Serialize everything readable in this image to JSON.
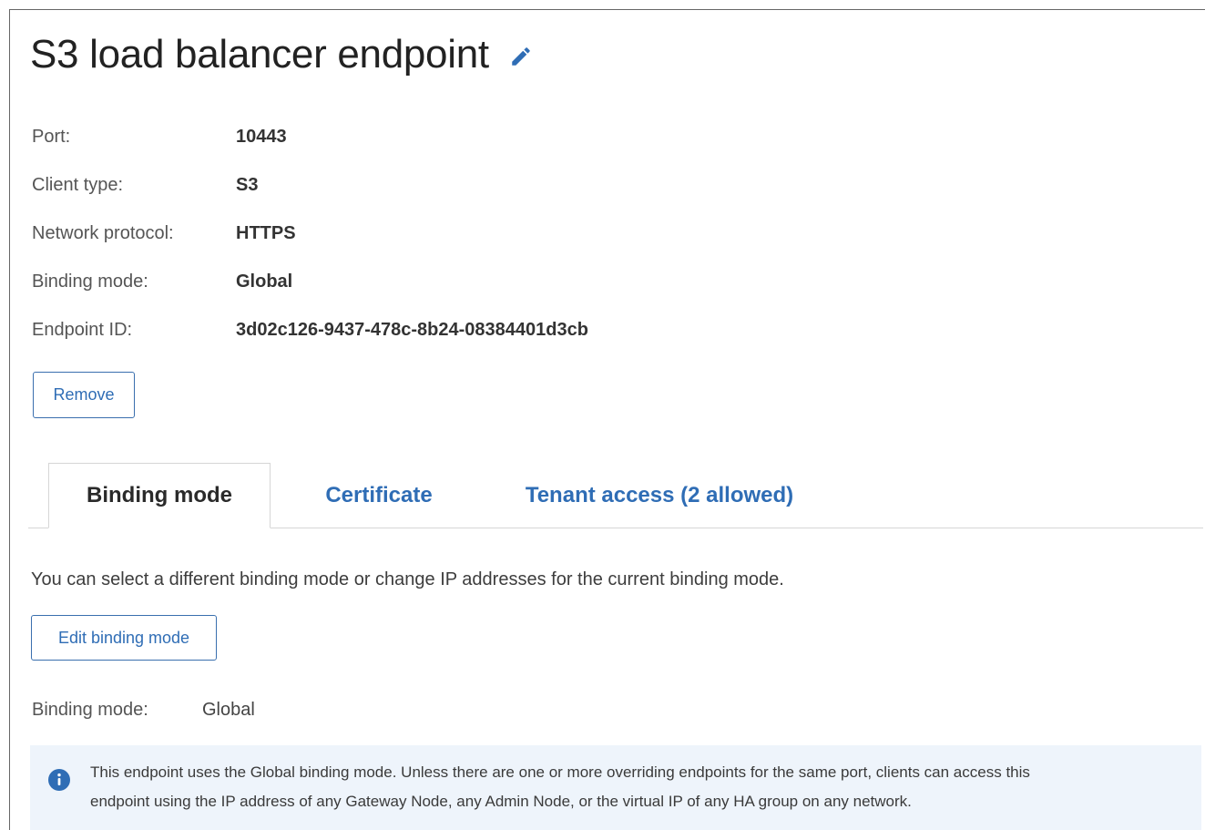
{
  "header": {
    "title": "S3 load balancer endpoint",
    "edit_icon": "pencil-icon",
    "accent_color": "#2f6db5"
  },
  "properties": [
    {
      "label": "Port:",
      "value": "10443"
    },
    {
      "label": "Client type:",
      "value": "S3"
    },
    {
      "label": "Network protocol:",
      "value": "HTTPS"
    },
    {
      "label": "Binding mode:",
      "value": "Global"
    },
    {
      "label": "Endpoint ID:",
      "value": "3d02c126-9437-478c-8b24-08384401d3cb"
    }
  ],
  "actions": {
    "remove_label": "Remove"
  },
  "tabs": [
    {
      "label": "Binding mode",
      "active": true
    },
    {
      "label": "Certificate",
      "active": false
    },
    {
      "label": "Tenant access (2 allowed)",
      "active": false
    }
  ],
  "binding_panel": {
    "description": "You can select a different binding mode or change IP addresses for the current binding mode.",
    "edit_button_label": "Edit binding mode",
    "mode_label": "Binding mode:",
    "mode_value": "Global",
    "info_icon": "info-icon",
    "info_line1": "This endpoint uses the Global binding mode. Unless there are one or more overriding endpoints for the same port, clients can access this",
    "info_line2": "endpoint using the IP address of any Gateway Node, any Admin Node, or the virtual IP of any HA group on any network.",
    "info_bg_color": "#eef4fb"
  }
}
